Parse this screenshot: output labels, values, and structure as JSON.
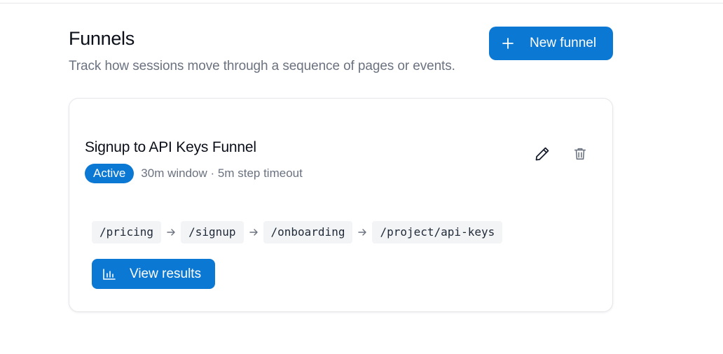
{
  "header": {
    "title": "Funnels",
    "subtitle": "Track how sessions move through a sequence of pages or events.",
    "new_button_label": "New funnel"
  },
  "funnel": {
    "name": "Signup to API Keys Funnel",
    "status": "Active",
    "meta": "30m window · 5m step timeout",
    "steps": [
      "/pricing",
      "/signup",
      "/onboarding",
      "/project/api-keys"
    ],
    "view_results_label": "View results"
  },
  "icons": {
    "new": "plus-icon",
    "edit": "pencil-icon",
    "delete": "trash-icon",
    "step_separator": "arrow-right-icon",
    "results": "bar-chart-icon"
  },
  "colors": {
    "accent": "#0b78d3",
    "muted_text": "#6b7280",
    "chip_bg": "#f3f4f6",
    "border": "#e5e7eb"
  }
}
